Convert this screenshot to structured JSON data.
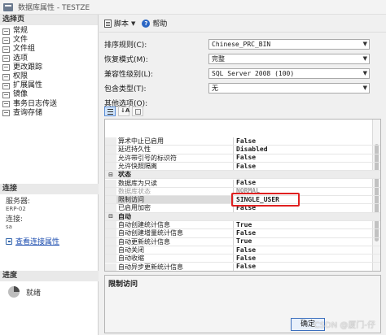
{
  "window": {
    "title": "数据库属性 - TESTZE"
  },
  "left_pane": {
    "select_page_header": "选择页",
    "pages": [
      {
        "label": "常规"
      },
      {
        "label": "文件"
      },
      {
        "label": "文件组"
      },
      {
        "label": "选项"
      },
      {
        "label": "更改跟踪"
      },
      {
        "label": "权限"
      },
      {
        "label": "扩展属性"
      },
      {
        "label": "镜像"
      },
      {
        "label": "事务日志传送"
      },
      {
        "label": "查询存储"
      }
    ],
    "connection_header": "连接",
    "server_label": "服务器:",
    "server_value": "ERP-02",
    "conn_label": "连接:",
    "conn_value": "sa",
    "view_conn_link": "查看连接属性",
    "progress_header": "进度",
    "progress_status": "就绪"
  },
  "toolbar": {
    "script_label": "脚本",
    "help_label": "帮助"
  },
  "form": {
    "collation_label": "排序规则(C):",
    "collation_value": "Chinese_PRC_BIN",
    "recovery_label": "恢复模式(M):",
    "recovery_value": "完整",
    "compat_label": "兼容性级别(L):",
    "compat_value": "SQL Server 2008 (100)",
    "containment_label": "包含类型(T):",
    "containment_value": "无",
    "other_options_label": "其他选项(O):"
  },
  "property_grid": {
    "rows": [
      {
        "kind": "prop",
        "name": "算术中止已启用",
        "value": "False"
      },
      {
        "kind": "prop",
        "name": "延迟持久性",
        "value": "Disabled"
      },
      {
        "kind": "prop",
        "name": "允许带引号的标识符",
        "value": "False"
      },
      {
        "kind": "prop",
        "name": "允许快照隔离",
        "value": "False"
      },
      {
        "kind": "category",
        "name": "状态",
        "value": ""
      },
      {
        "kind": "prop",
        "name": "数据库为只读",
        "value": "False"
      },
      {
        "kind": "disabled",
        "name": "数据库状态",
        "value": "NORMAL"
      },
      {
        "kind": "selected",
        "name": "限制访问",
        "value": "SINGLE_USER"
      },
      {
        "kind": "prop",
        "name": "已启用加密",
        "value": "False"
      },
      {
        "kind": "category",
        "name": "自动",
        "value": ""
      },
      {
        "kind": "prop",
        "name": "自动创建统计信息",
        "value": "True"
      },
      {
        "kind": "prop",
        "name": "自动创建增量统计信息",
        "value": "False"
      },
      {
        "kind": "prop",
        "name": "自动更新统计信息",
        "value": "True"
      },
      {
        "kind": "prop",
        "name": "自动关闭",
        "value": "False"
      },
      {
        "kind": "prop",
        "name": "自动收缩",
        "value": "False"
      },
      {
        "kind": "prop",
        "name": "自动异步更新统计信息",
        "value": "False"
      }
    ]
  },
  "description": {
    "title": "限制访问"
  },
  "buttons": {
    "ok_label": "确定"
  },
  "watermark": {
    "text": "CSDN @厦门-仔"
  },
  "colors": {
    "highlight": "#e02020",
    "link": "#1f4fb0",
    "selected_tool": "#cfe3fb"
  }
}
